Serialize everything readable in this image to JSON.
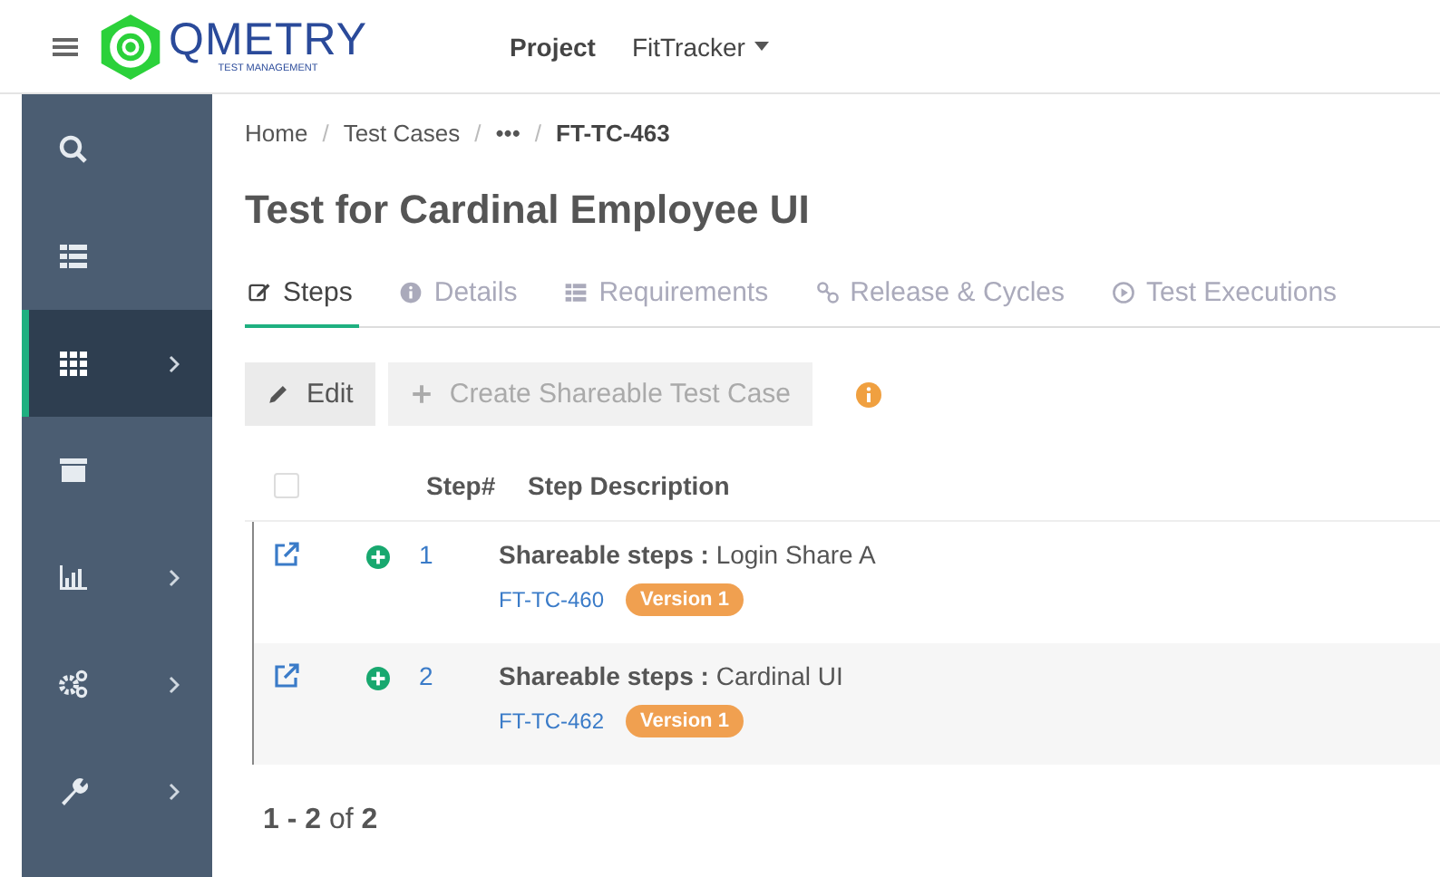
{
  "header": {
    "logo": {
      "name": "QMETRY",
      "tagline": "TEST MANAGEMENT"
    },
    "nav": [
      {
        "label": "Project",
        "dropdown": false
      },
      {
        "label": "FitTracker",
        "dropdown": true
      }
    ]
  },
  "sidebar": {
    "items": [
      {
        "kind": "search",
        "selected": false,
        "has_submenu": false
      },
      {
        "kind": "list",
        "selected": false,
        "has_submenu": false
      },
      {
        "kind": "grid",
        "selected": true,
        "has_submenu": true
      },
      {
        "kind": "archive",
        "selected": false,
        "has_submenu": false
      },
      {
        "kind": "chart",
        "selected": false,
        "has_submenu": true
      },
      {
        "kind": "gears",
        "selected": false,
        "has_submenu": true
      },
      {
        "kind": "wrench",
        "selected": false,
        "has_submenu": true
      }
    ]
  },
  "breadcrumb": [
    {
      "label": "Home",
      "current": false
    },
    {
      "separator": "/",
      "label": "Test Cases",
      "current": false
    },
    {
      "separator": "/",
      "label": "•••",
      "current": false
    },
    {
      "separator": "/",
      "label": "FT-TC-463",
      "current": true
    }
  ],
  "title": "Test for Cardinal Employee UI",
  "tabs": [
    {
      "kind": "edit",
      "label": "Steps",
      "selected": true
    },
    {
      "kind": "info",
      "label": "Details",
      "selected": false
    },
    {
      "kind": "list",
      "label": "Requirements",
      "selected": false
    },
    {
      "kind": "link",
      "label": "Release & Cycles",
      "selected": false
    },
    {
      "kind": "play",
      "label": "Test Executions",
      "selected": false
    }
  ],
  "actions": [
    {
      "kind": "edit",
      "label": "Edit",
      "disabled": false
    },
    {
      "kind": "add",
      "label": "Create Shareable Test Case",
      "disabled": true
    }
  ],
  "table": {
    "select_all": {
      "checked": false
    },
    "columns": [
      "Step#",
      "Step Description"
    ],
    "rows": [
      {
        "step": "1",
        "label": "Shareable steps :",
        "description": "Login Share A",
        "link": "FT-TC-460",
        "badge": "Version 1"
      },
      {
        "step": "2",
        "label": "Shareable steps :",
        "description": "Cardinal UI",
        "link": "FT-TC-462",
        "badge": "Version 1"
      }
    ]
  },
  "pagination": "**1 - 2** of **2**"
}
